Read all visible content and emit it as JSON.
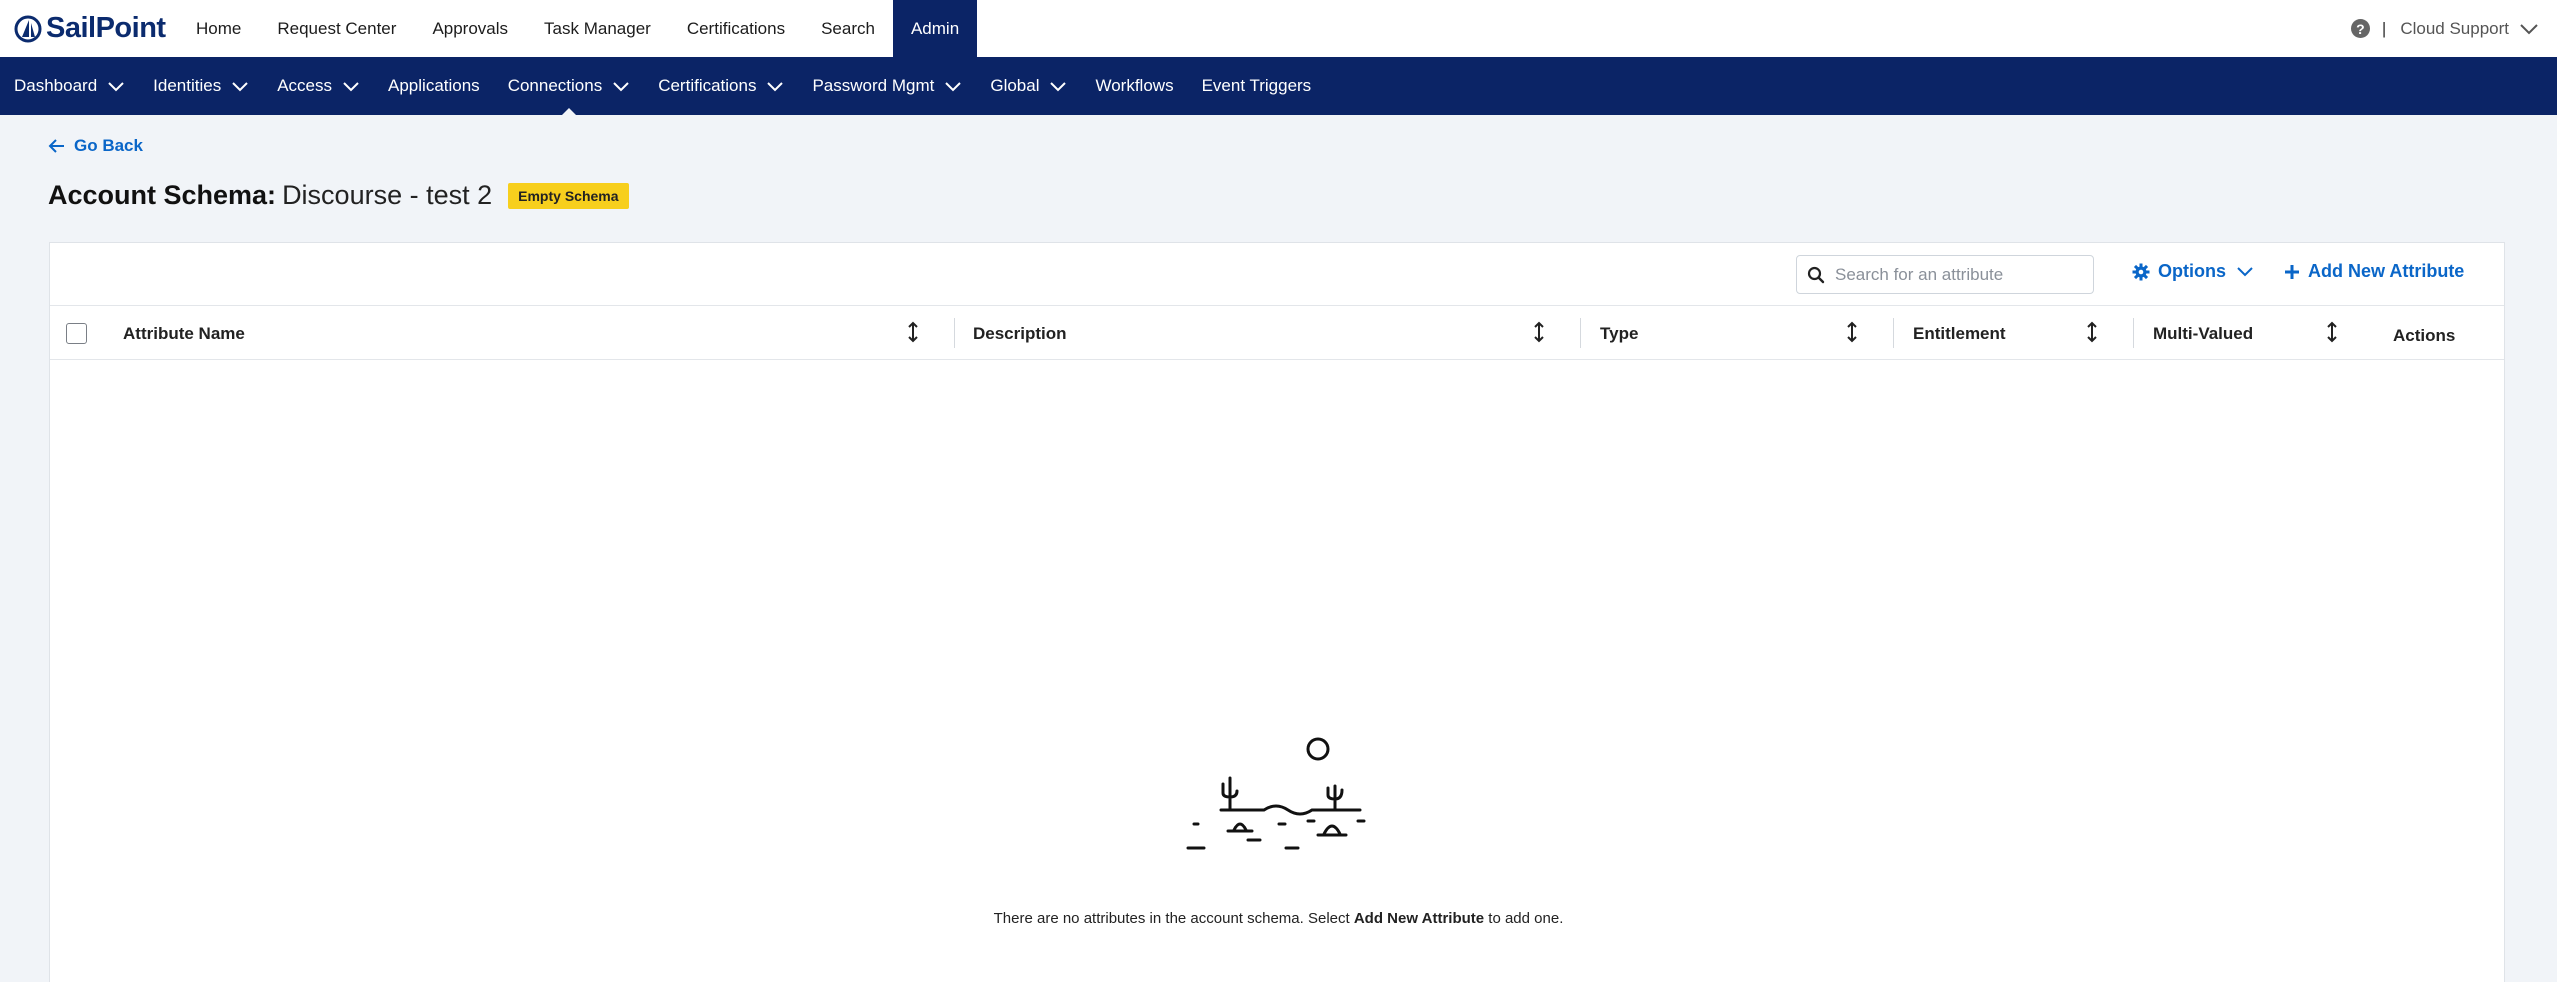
{
  "brand": {
    "name": "SailPoint",
    "color": "#0b2b6e"
  },
  "top_nav": {
    "items": [
      "Home",
      "Request Center",
      "Approvals",
      "Task Manager",
      "Certifications",
      "Search",
      "Admin"
    ],
    "active": "Admin",
    "user": "Cloud Support"
  },
  "sub_nav": {
    "items": [
      {
        "label": "Dashboard",
        "dropdown": true
      },
      {
        "label": "Identities",
        "dropdown": true
      },
      {
        "label": "Access",
        "dropdown": true
      },
      {
        "label": "Applications",
        "dropdown": false
      },
      {
        "label": "Connections",
        "dropdown": true
      },
      {
        "label": "Certifications",
        "dropdown": true
      },
      {
        "label": "Password Mgmt",
        "dropdown": true
      },
      {
        "label": "Global",
        "dropdown": true
      },
      {
        "label": "Workflows",
        "dropdown": false
      },
      {
        "label": "Event Triggers",
        "dropdown": false
      }
    ],
    "active": "Connections"
  },
  "page": {
    "back_label": "Go Back",
    "title_prefix": "Account Schema:",
    "title_name": "Discourse - test 2",
    "badge": "Empty Schema"
  },
  "toolbar": {
    "search_placeholder": "Search for an attribute",
    "options_label": "Options",
    "add_label": "Add New Attribute"
  },
  "table": {
    "columns": [
      "Attribute Name",
      "Description",
      "Type",
      "Entitlement",
      "Multi-Valued",
      "Actions"
    ]
  },
  "empty_state": {
    "message_before": "There are no attributes in the account schema. Select ",
    "message_bold": "Add New Attribute",
    "message_after": " to add one."
  },
  "colors": {
    "nav_dark": "#0b2466",
    "link_blue": "#0a66c8",
    "badge_yellow": "#f7cf1d",
    "page_bg": "#f1f4f8"
  }
}
